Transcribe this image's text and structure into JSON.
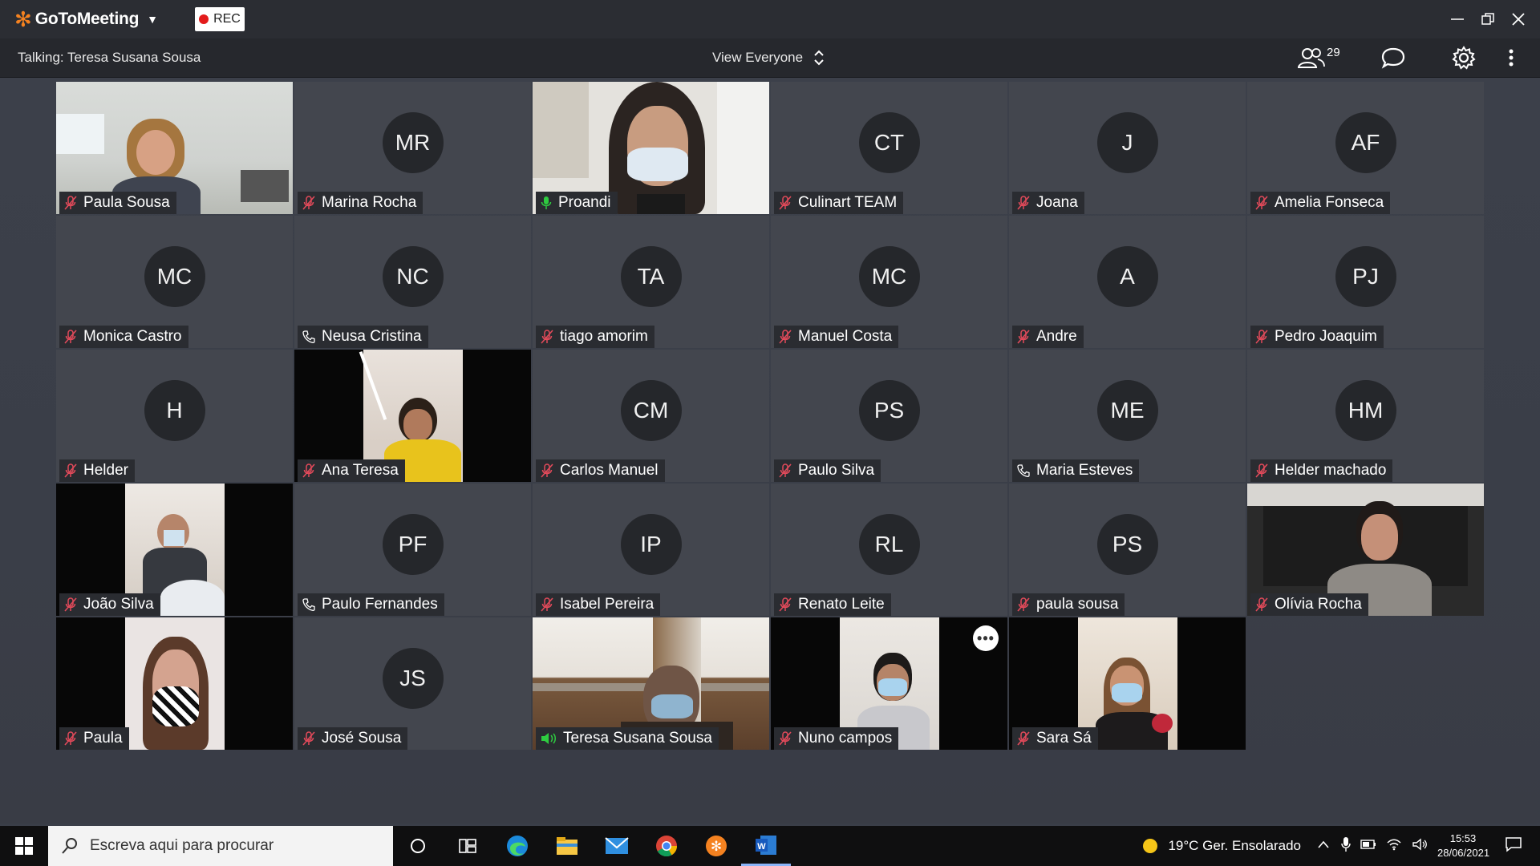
{
  "app": {
    "name": "GoToMeeting",
    "rec_label": "REC",
    "talking": "Talking: Teresa Susana Sousa",
    "view_label": "View Everyone",
    "participant_count": "29",
    "accent": "#f58220"
  },
  "participants": [
    {
      "name": "Paula Sousa",
      "initials": "",
      "video": true,
      "mic": "muted"
    },
    {
      "name": "Marina Rocha",
      "initials": "MR",
      "video": false,
      "mic": "muted"
    },
    {
      "name": "Proandi",
      "initials": "",
      "video": true,
      "mic": "active"
    },
    {
      "name": "Culinart TEAM",
      "initials": "CT",
      "video": false,
      "mic": "muted"
    },
    {
      "name": "Joana",
      "initials": "J",
      "video": false,
      "mic": "muted"
    },
    {
      "name": "Amelia Fonseca",
      "initials": "AF",
      "video": false,
      "mic": "muted"
    },
    {
      "name": "Monica Castro",
      "initials": "MC",
      "video": false,
      "mic": "muted"
    },
    {
      "name": "Neusa Cristina",
      "initials": "NC",
      "video": false,
      "mic": "phone"
    },
    {
      "name": "tiago amorim",
      "initials": "TA",
      "video": false,
      "mic": "muted"
    },
    {
      "name": "Manuel Costa",
      "initials": "MC",
      "video": false,
      "mic": "muted"
    },
    {
      "name": "Andre",
      "initials": "A",
      "video": false,
      "mic": "muted"
    },
    {
      "name": "Pedro Joaquim",
      "initials": "PJ",
      "video": false,
      "mic": "muted"
    },
    {
      "name": "Helder",
      "initials": "H",
      "video": false,
      "mic": "muted"
    },
    {
      "name": "Ana Teresa",
      "initials": "",
      "video": true,
      "mic": "muted"
    },
    {
      "name": "Carlos Manuel",
      "initials": "CM",
      "video": false,
      "mic": "muted"
    },
    {
      "name": "Paulo Silva",
      "initials": "PS",
      "video": false,
      "mic": "muted"
    },
    {
      "name": "Maria Esteves",
      "initials": "ME",
      "video": false,
      "mic": "phone"
    },
    {
      "name": "Helder machado",
      "initials": "HM",
      "video": false,
      "mic": "muted"
    },
    {
      "name": "João Silva",
      "initials": "",
      "video": true,
      "mic": "muted"
    },
    {
      "name": "Paulo Fernandes",
      "initials": "PF",
      "video": false,
      "mic": "phone"
    },
    {
      "name": "Isabel Pereira",
      "initials": "IP",
      "video": false,
      "mic": "muted"
    },
    {
      "name": "Renato Leite",
      "initials": "RL",
      "video": false,
      "mic": "muted"
    },
    {
      "name": "paula sousa",
      "initials": "PS",
      "video": false,
      "mic": "muted"
    },
    {
      "name": "Olívia Rocha",
      "initials": "",
      "video": true,
      "mic": "muted"
    },
    {
      "name": "Paula",
      "initials": "",
      "video": true,
      "mic": "muted"
    },
    {
      "name": "José Sousa",
      "initials": "JS",
      "video": false,
      "mic": "muted"
    },
    {
      "name": "Teresa Susana Sousa",
      "initials": "",
      "video": true,
      "mic": "speaking"
    },
    {
      "name": "Nuno campos",
      "initials": "",
      "video": true,
      "mic": "muted"
    },
    {
      "name": "Sara Sá",
      "initials": "",
      "video": true,
      "mic": "muted"
    }
  ],
  "taskbar": {
    "search_placeholder": "Escreva aqui para procurar",
    "weather": "19°C  Ger. Ensolarado",
    "time": "15:53",
    "date": "28/06/2021",
    "apps": [
      "cortana-icon",
      "task-view-icon",
      "edge-icon",
      "file-explorer-icon",
      "mail-icon",
      "chrome-icon",
      "gotomeeting-icon",
      "word-icon"
    ]
  }
}
